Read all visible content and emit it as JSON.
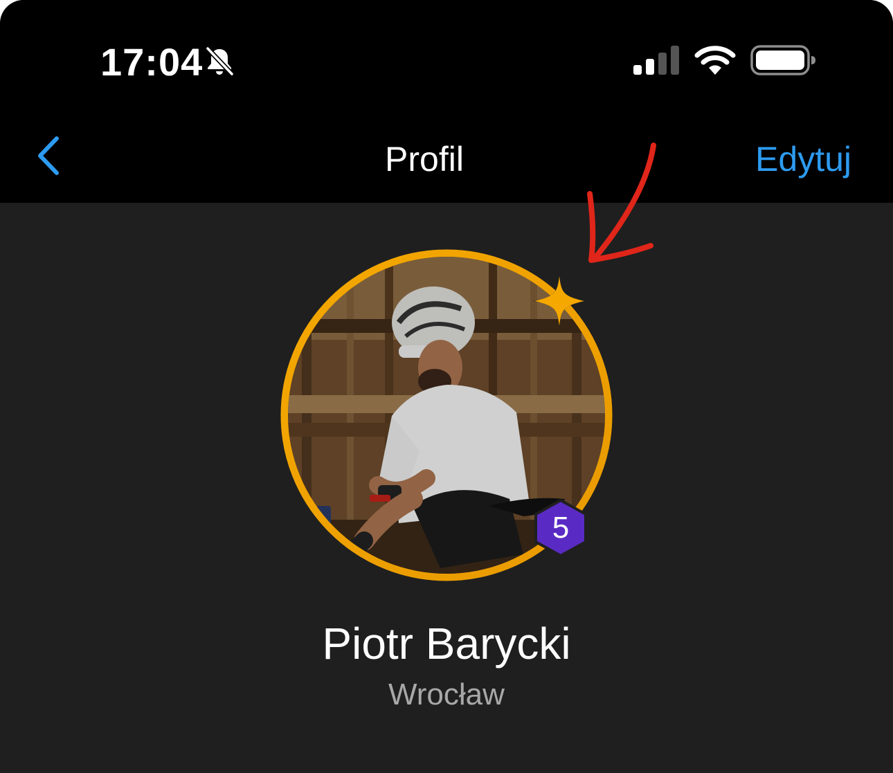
{
  "status_bar": {
    "time": "17:04",
    "icons": [
      "bell-slash-icon",
      "cellular-signal-icon",
      "wifi-icon",
      "battery-icon"
    ],
    "cellular_bars_active": 2,
    "cellular_bars_total": 4,
    "battery_level": 1.0
  },
  "nav": {
    "back_icon": "chevron-left-icon",
    "title": "Profil",
    "edit_label": "Edytuj"
  },
  "profile": {
    "name": "Piotr Barycki",
    "city": "Wrocław",
    "level": "5",
    "ring_icon": "sparkle-icon",
    "avatar": "cyclist-photo"
  },
  "colors": {
    "background": "#1f1f1f",
    "bars": "#000000",
    "accent_blue": "#2d9bf0",
    "ring_gold": "#f2a600",
    "badge_purple": "#5a2bc4",
    "annotation_red": "#e0261a",
    "secondary_text": "#a8a8a8"
  }
}
